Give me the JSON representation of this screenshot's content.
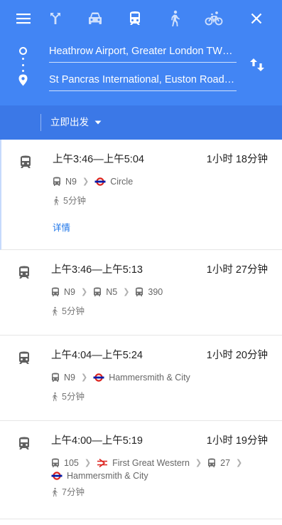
{
  "travel_modes": [
    {
      "name": "best-route",
      "icon": "route-fork-icon",
      "selected": false
    },
    {
      "name": "driving",
      "icon": "car-icon",
      "selected": false
    },
    {
      "name": "transit",
      "icon": "train-icon",
      "selected": true
    },
    {
      "name": "walking",
      "icon": "walk-icon",
      "selected": false
    },
    {
      "name": "cycling",
      "icon": "bike-icon",
      "selected": false
    }
  ],
  "origin": "Heathrow Airport, Greater London TW6, UK",
  "destination": "St Pancras International, Euston Road, London",
  "time_option": "立即出发",
  "routes": [
    {
      "times": "上午3:46—上午5:04",
      "duration": "1小时 18分钟",
      "legs": [
        {
          "type": "bus",
          "label": "N9"
        },
        {
          "type": "underground",
          "label": "Circle"
        }
      ],
      "walk": "5分钟",
      "details": "详情"
    },
    {
      "times": "上午3:46—上午5:13",
      "duration": "1小时 27分钟",
      "legs": [
        {
          "type": "bus",
          "label": "N9"
        },
        {
          "type": "bus",
          "label": "N5"
        },
        {
          "type": "bus",
          "label": "390"
        }
      ],
      "walk": "5分钟"
    },
    {
      "times": "上午4:04—上午5:24",
      "duration": "1小时 20分钟",
      "legs": [
        {
          "type": "bus",
          "label": "N9"
        },
        {
          "type": "underground",
          "label": "Hammersmith & City"
        }
      ],
      "walk": "5分钟"
    },
    {
      "times": "上午4:00—上午5:19",
      "duration": "1小时 19分钟",
      "legs": [
        {
          "type": "bus",
          "label": "105"
        },
        {
          "type": "national-rail",
          "label": "First Great Western"
        },
        {
          "type": "bus",
          "label": "27"
        },
        {
          "type": "underground",
          "label": "Hammersmith & City"
        }
      ],
      "walk": "7分钟"
    }
  ],
  "colors": {
    "header": "#4285f4",
    "time_bar": "#3b78e7",
    "link": "#1a73e8",
    "underground_red": "#dc241f",
    "underground_blue": "#0019a8"
  }
}
